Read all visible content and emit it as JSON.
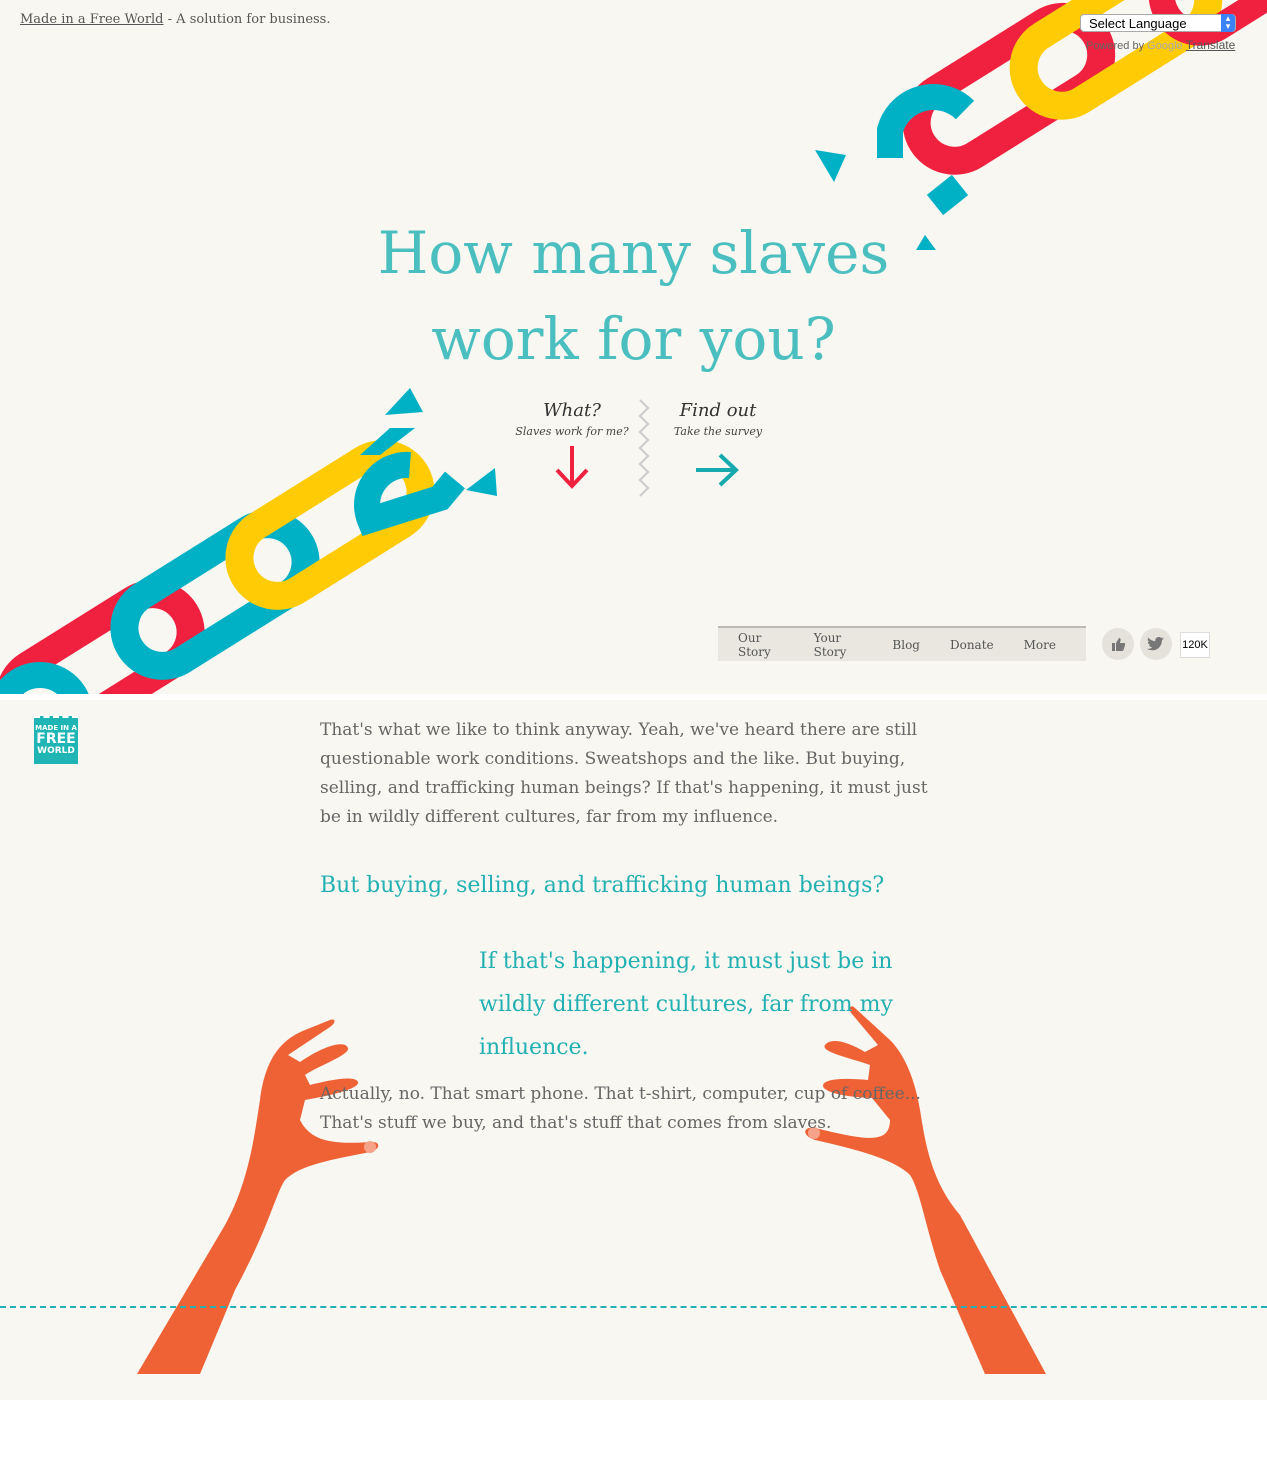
{
  "header": {
    "site_link": "Made in a Free World",
    "tagline": " - A solution for business.",
    "language_select": "Select Language",
    "powered_by": "Powered by ",
    "google": "Google",
    "translate": "Translate"
  },
  "hero": {
    "title_line1": "How many slaves",
    "title_line2": "work for you?",
    "cta_what_title": "What?",
    "cta_what_sub": "Slaves work for me?",
    "cta_find_title": "Find out",
    "cta_find_sub": "Take the survey"
  },
  "nav": {
    "items": [
      "Our Story",
      "Your Story",
      "Blog",
      "Donate",
      "More"
    ],
    "like_count": "120K"
  },
  "badge": {
    "line1": "MADE IN A",
    "line2": "FREE",
    "line3": "WORLD"
  },
  "content": {
    "para1": "That's what we like to think anyway. Yeah, we've heard there are still questionable work conditions. Sweatshops and the like. But buying, selling, and trafficking human beings? If that's happening, it must just be in wildly different cultures, far from my influence.",
    "quote1": "But buying, selling, and trafficking human beings?",
    "quote2": "If that's happening, it must just be in wildly different cultures, far from my influence.",
    "para2": "Actually, no. That smart phone. That t-shirt, computer, cup of coffee... That's stuff we buy, and that's stuff that comes from slaves."
  },
  "colors": {
    "teal": "#4bbfbf",
    "red": "#f0203f",
    "yellow": "#ffcb05",
    "blue": "#00b1c6",
    "hand": "#ef6236"
  }
}
